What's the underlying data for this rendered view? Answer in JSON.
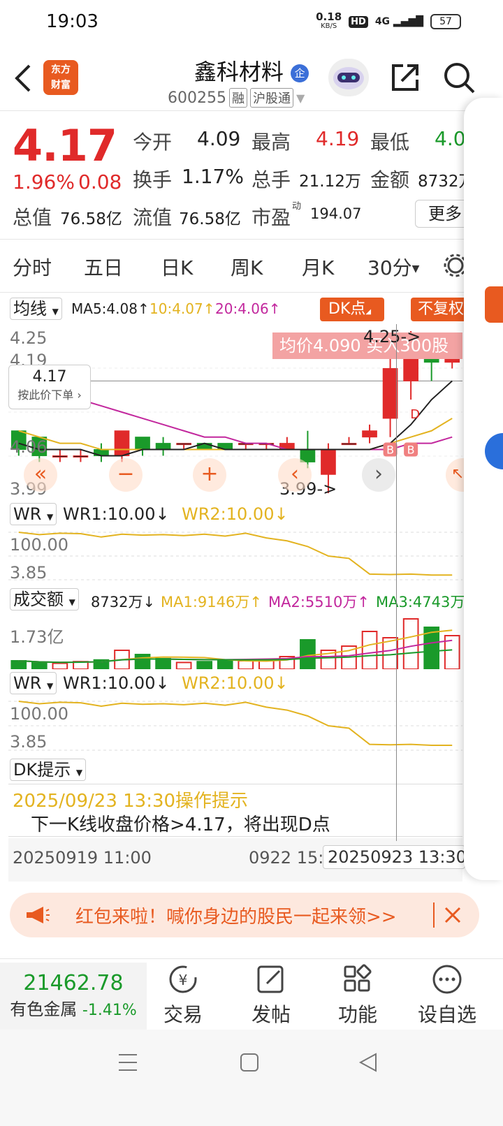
{
  "status": {
    "time": "19:03",
    "net_speed": "0.18",
    "net_unit": "KB/S",
    "hd": "HD",
    "sig": "4G",
    "battery": "57"
  },
  "header": {
    "logo_line1": "东方",
    "logo_line2": "财富",
    "title": "鑫科材料",
    "enterprise_badge": "企",
    "code": "600255",
    "tag1": "融",
    "tag2": "沪股通"
  },
  "quote": {
    "price": "4.17",
    "change_pct": "1.96%",
    "change_amt": "0.08",
    "open_label": "今开",
    "open": "4.09",
    "high_label": "最高",
    "high": "4.19",
    "low_label": "最低",
    "low": "4.0",
    "turnover_label": "换手",
    "turnover": "1.17%",
    "volume_label": "总手",
    "volume": "21.12万",
    "amount_label": "金额",
    "amount": "8732万",
    "mcap_label": "总值",
    "mcap": "76.58亿",
    "float_label": "流值",
    "float_cap": "76.58亿",
    "pe_label": "市盈",
    "pe_sup": "动",
    "pe": "194.07",
    "more": "更多"
  },
  "tabs": [
    "分时",
    "五日",
    "日K",
    "周K",
    "月K",
    "30分"
  ],
  "chart": {
    "ma_select": "均线",
    "ma5": "MA5:4.08",
    "ma10": "10:4.07",
    "ma20": "20:4.06",
    "dk_btn": "DK点",
    "fq_btn": "不复权",
    "y_top": "4.25",
    "y_2": "4.19",
    "y_mid": "4.06",
    "y_bot": "3.99",
    "crosshair_price": "4.17",
    "crosshair_action": "按此价下单",
    "hi_mark": "4.25->",
    "lo_mark": "3.99->",
    "tip": "均价4.090  买入300股",
    "wr_select": "WR",
    "wr1": "WR1:10.00",
    "wr2": "WR2:10.00",
    "wr_top": "100.00",
    "wr_bot": "3.85",
    "vol_select": "成交额",
    "vol_val": "8732万",
    "vol_ma1": "MA1:9146万",
    "vol_ma2": "MA2:5510万",
    "vol_ma3": "MA3:4743万",
    "vol_top": "1.73亿",
    "dk_select": "DK提示",
    "dk_date": "2025/09/23 13:30操作提示",
    "dk_msg": "下一K线收盘价格>4.17，将出现D点",
    "t_left": "20250919 11:00",
    "t_mid": "0922 15:0",
    "t_right": "20250923 13:30",
    "b_mark": "B",
    "d_mark": "D"
  },
  "chart_data": {
    "type": "candlestick",
    "candles": [
      {
        "o": 4.09,
        "c": 4.06,
        "h": 4.09,
        "l": 4.05
      },
      {
        "o": 4.08,
        "c": 4.05,
        "h": 4.08,
        "l": 4.04
      },
      {
        "o": 4.05,
        "c": 4.05,
        "h": 4.06,
        "l": 4.04
      },
      {
        "o": 4.05,
        "c": 4.05,
        "h": 4.06,
        "l": 4.04
      },
      {
        "o": 4.06,
        "c": 4.05,
        "h": 4.07,
        "l": 4.04
      },
      {
        "o": 4.05,
        "c": 4.09,
        "h": 4.09,
        "l": 4.04
      },
      {
        "o": 4.08,
        "c": 4.06,
        "h": 4.08,
        "l": 4.05
      },
      {
        "o": 4.07,
        "c": 4.06,
        "h": 4.08,
        "l": 4.05
      },
      {
        "o": 4.07,
        "c": 4.07,
        "h": 4.07,
        "l": 4.06
      },
      {
        "o": 4.07,
        "c": 4.06,
        "h": 4.07,
        "l": 4.06
      },
      {
        "o": 4.07,
        "c": 4.06,
        "h": 4.07,
        "l": 4.06
      },
      {
        "o": 4.07,
        "c": 4.07,
        "h": 4.07,
        "l": 4.06
      },
      {
        "o": 4.07,
        "c": 4.07,
        "h": 4.07,
        "l": 4.06
      },
      {
        "o": 4.06,
        "c": 4.07,
        "h": 4.08,
        "l": 4.06
      },
      {
        "o": 4.06,
        "c": 4.04,
        "h": 4.09,
        "l": 4.03
      },
      {
        "o": 4.02,
        "c": 4.06,
        "h": 4.07,
        "l": 3.99
      },
      {
        "o": 4.07,
        "c": 4.07,
        "h": 4.08,
        "l": 4.07
      },
      {
        "o": 4.08,
        "c": 4.09,
        "h": 4.1,
        "l": 4.07
      },
      {
        "o": 4.11,
        "c": 4.19,
        "h": 4.21,
        "l": 4.08
      },
      {
        "o": 4.17,
        "c": 4.21,
        "h": 4.25,
        "l": 4.14
      },
      {
        "o": 4.21,
        "c": 4.2,
        "h": 4.23,
        "l": 4.17
      },
      {
        "o": 4.2,
        "c": 4.22,
        "h": 4.23,
        "l": 4.19
      }
    ],
    "ma5": [
      4.07,
      4.06,
      4.06,
      4.06,
      4.05,
      4.05,
      4.06,
      4.06,
      4.06,
      4.07,
      4.06,
      4.06,
      4.06,
      4.06,
      4.06,
      4.06,
      4.06,
      4.06,
      4.07,
      4.1,
      4.14,
      4.17
    ],
    "ma10": [
      4.09,
      4.08,
      4.07,
      4.07,
      4.06,
      4.06,
      4.06,
      4.06,
      4.06,
      4.06,
      4.06,
      4.06,
      4.06,
      4.06,
      4.06,
      4.06,
      4.06,
      4.06,
      4.07,
      4.08,
      4.09,
      4.11
    ],
    "ma20": [
      4.17,
      4.16,
      4.15,
      4.14,
      4.13,
      4.12,
      4.11,
      4.1,
      4.09,
      4.08,
      4.08,
      4.07,
      4.07,
      4.06,
      4.06,
      4.06,
      4.06,
      4.06,
      4.06,
      4.07,
      4.07,
      4.08
    ],
    "ylim": [
      3.99,
      4.25
    ],
    "wr1": [
      100,
      95,
      98,
      97,
      90,
      96,
      94,
      95,
      93,
      96,
      92,
      98,
      88,
      82,
      70,
      50,
      45,
      12,
      11,
      12,
      10,
      10
    ],
    "volume": [
      2,
      1.5,
      1.4,
      1.8,
      2.2,
      4.5,
      3.5,
      2.5,
      1.6,
      1.8,
      2,
      2,
      2.2,
      3,
      7,
      4.5,
      5.5,
      9,
      7.5,
      12,
      10,
      8
    ]
  },
  "banner": {
    "text": "红包来啦！喊你身边的股民一起来领>>"
  },
  "bottom": {
    "index_val": "21462.78",
    "index_name": "有色金属",
    "index_chg": "-1.41%",
    "nav": [
      "交易",
      "发帖",
      "功能",
      "设自选"
    ]
  }
}
